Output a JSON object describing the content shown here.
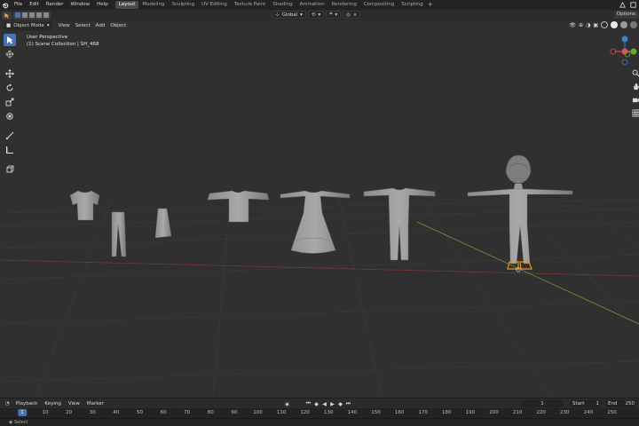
{
  "menu": {
    "items": [
      "File",
      "Edit",
      "Render",
      "Window",
      "Help"
    ]
  },
  "workspaces": {
    "active_index": 0,
    "tabs": [
      "Layout",
      "Modeling",
      "Sculpting",
      "UV Editing",
      "Texture Paint",
      "Shading",
      "Animation",
      "Rendering",
      "Compositing",
      "Scripting"
    ]
  },
  "tool_header": {
    "transform_orientation": "Global",
    "options_label": "Options"
  },
  "viewport_header": {
    "mode": "Object Mode",
    "menus": [
      "View",
      "Select",
      "Add",
      "Object"
    ]
  },
  "viewport": {
    "view_name": "User Perspective",
    "collection_info": "(1) Scene Collection | SH_468",
    "objects": [
      {
        "name": "shirt",
        "kind": "garment-shirt"
      },
      {
        "name": "pants",
        "kind": "garment-pants"
      },
      {
        "name": "skirt",
        "kind": "garment-skirt"
      },
      {
        "name": "jacket",
        "kind": "garment-jacket"
      },
      {
        "name": "dress",
        "kind": "garment-dress"
      },
      {
        "name": "suit",
        "kind": "garment-suit"
      },
      {
        "name": "character",
        "kind": "character-selected"
      }
    ]
  },
  "timeline": {
    "menus": [
      "Playback",
      "Keying",
      "View",
      "Marker"
    ],
    "current_frame": "1",
    "start_label": "Start",
    "start_value": "1",
    "end_label": "End",
    "end_value": "250",
    "ticks": [
      "1",
      "10",
      "20",
      "30",
      "40",
      "50",
      "60",
      "70",
      "80",
      "90",
      "100",
      "110",
      "120",
      "130",
      "140",
      "150",
      "160",
      "170",
      "180",
      "190",
      "200",
      "210",
      "220",
      "230",
      "240",
      "250"
    ]
  },
  "colors": {
    "accent": "#4772b3",
    "selected_object": "#e8922a",
    "axis_x": "#c23a3a",
    "axis_y": "#7da23a",
    "gizmo_x": "#e34e5b",
    "gizmo_y": "#6ea632",
    "gizmo_z": "#3b80d0"
  },
  "icons": {
    "logo": "blender-logo-icon",
    "select_box": "select-box-icon",
    "cursor": "cursor-icon",
    "move": "move-icon",
    "rotate": "rotate-icon",
    "scale": "scale-icon",
    "transform": "transform-icon",
    "annotate": "annotate-icon",
    "measure": "measure-icon",
    "add_cube": "add-cube-icon"
  }
}
